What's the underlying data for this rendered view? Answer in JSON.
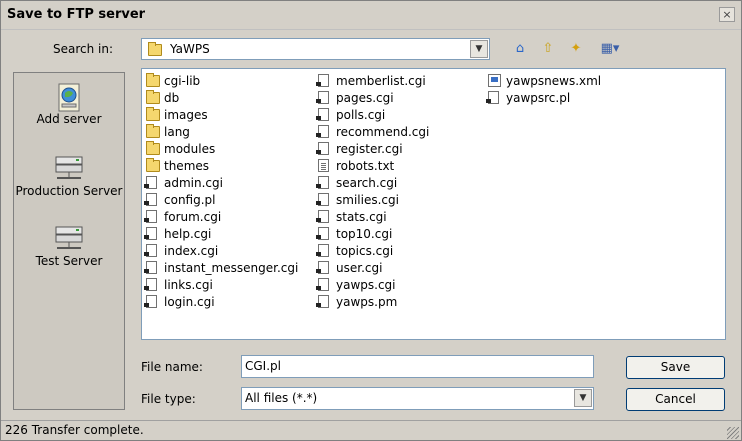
{
  "window": {
    "title": "Save to FTP server",
    "close_glyph": "×"
  },
  "search": {
    "label": "Search in:",
    "location": "YaWPS"
  },
  "toolbar": {
    "icons": [
      "home-up-icon",
      "up-folder-icon",
      "new-folder-icon",
      "view-menu-icon"
    ]
  },
  "places": [
    {
      "label": "Add server",
      "icon": "add-server-icon"
    },
    {
      "label": "Production Server",
      "icon": "server-icon"
    },
    {
      "label": "Test Server",
      "icon": "server-icon"
    }
  ],
  "files": {
    "column1": [
      {
        "name": "cgi-lib",
        "type": "folder"
      },
      {
        "name": "db",
        "type": "folder"
      },
      {
        "name": "images",
        "type": "folder"
      },
      {
        "name": "lang",
        "type": "folder"
      },
      {
        "name": "modules",
        "type": "folder"
      },
      {
        "name": "themes",
        "type": "folder"
      },
      {
        "name": "admin.cgi",
        "type": "script"
      },
      {
        "name": "config.pl",
        "type": "script"
      },
      {
        "name": "forum.cgi",
        "type": "script"
      },
      {
        "name": "help.cgi",
        "type": "script"
      },
      {
        "name": "index.cgi",
        "type": "script"
      },
      {
        "name": "instant_messenger.cgi",
        "type": "script"
      },
      {
        "name": "links.cgi",
        "type": "script"
      },
      {
        "name": "login.cgi",
        "type": "script"
      }
    ],
    "column2": [
      {
        "name": "memberlist.cgi",
        "type": "script"
      },
      {
        "name": "pages.cgi",
        "type": "script"
      },
      {
        "name": "polls.cgi",
        "type": "script"
      },
      {
        "name": "recommend.cgi",
        "type": "script"
      },
      {
        "name": "register.cgi",
        "type": "script"
      },
      {
        "name": "robots.txt",
        "type": "text"
      },
      {
        "name": "search.cgi",
        "type": "script"
      },
      {
        "name": "smilies.cgi",
        "type": "script"
      },
      {
        "name": "stats.cgi",
        "type": "script"
      },
      {
        "name": "top10.cgi",
        "type": "script"
      },
      {
        "name": "topics.cgi",
        "type": "script"
      },
      {
        "name": "user.cgi",
        "type": "script"
      },
      {
        "name": "yawps.cgi",
        "type": "script"
      },
      {
        "name": "yawps.pm",
        "type": "script"
      }
    ],
    "column3": [
      {
        "name": "yawpsnews.xml",
        "type": "xml"
      },
      {
        "name": "yawpsrc.pl",
        "type": "script"
      }
    ]
  },
  "filename": {
    "label": "File name:",
    "value": "CGI.pl"
  },
  "filetype": {
    "label": "File type:",
    "value": "All files (*.*)"
  },
  "buttons": {
    "save": "Save",
    "cancel": "Cancel"
  },
  "status": {
    "text": "226 Transfer complete."
  }
}
